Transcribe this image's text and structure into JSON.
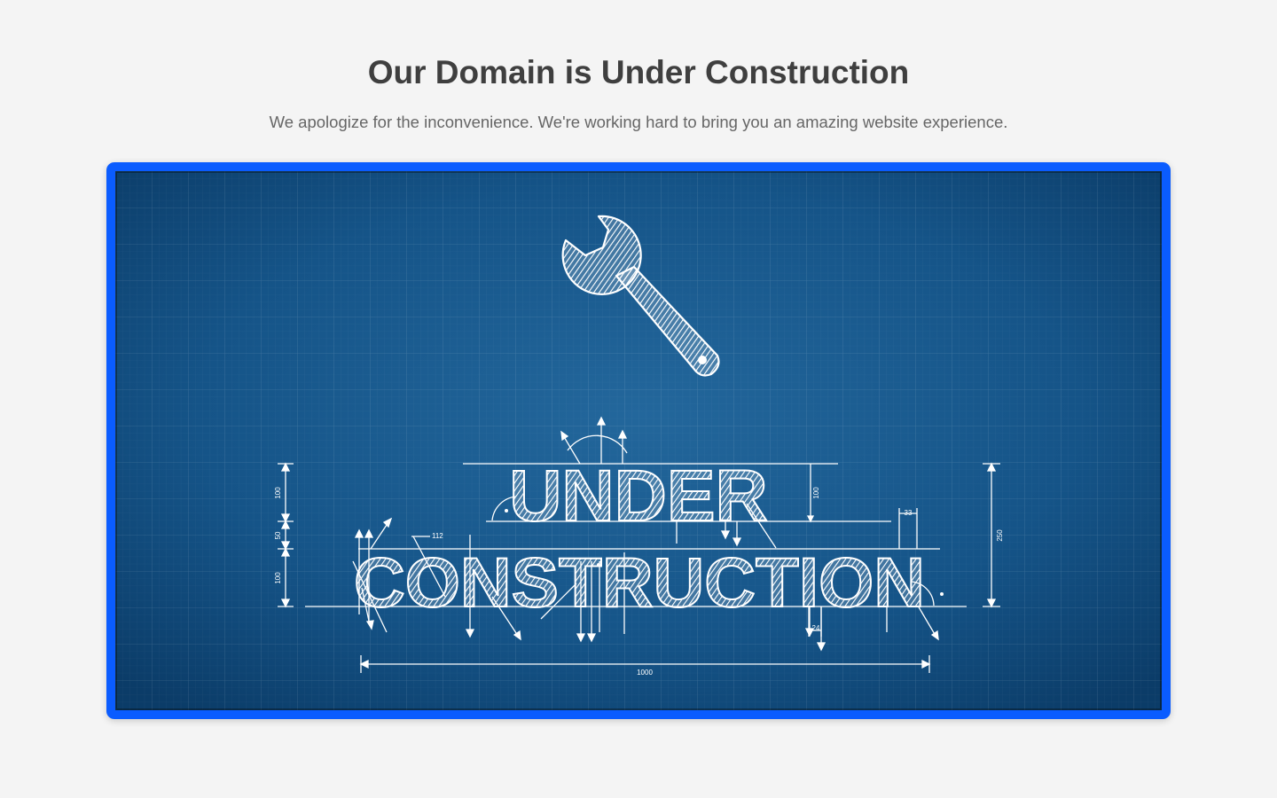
{
  "page": {
    "title": "Our Domain is Under Construction",
    "subtitle": "We apologize for the inconvenience. We're working hard to bring you an amazing website experience."
  },
  "illustration": {
    "icon": "wrench-icon",
    "line1": "UNDER",
    "line2": "CONSTRUCTION",
    "dimensions": {
      "d100_a": "100",
      "d50": "50",
      "d100_b": "100",
      "d100_c": "100",
      "d112": "112",
      "d33": "33",
      "d24": "24",
      "d250": "250",
      "d1000": "1000"
    }
  },
  "colors": {
    "frame": "#0a5cff",
    "blueprint_center": "#1f6fa8",
    "blueprint_edge": "#0b3f6e",
    "ink": "#ffffff"
  }
}
